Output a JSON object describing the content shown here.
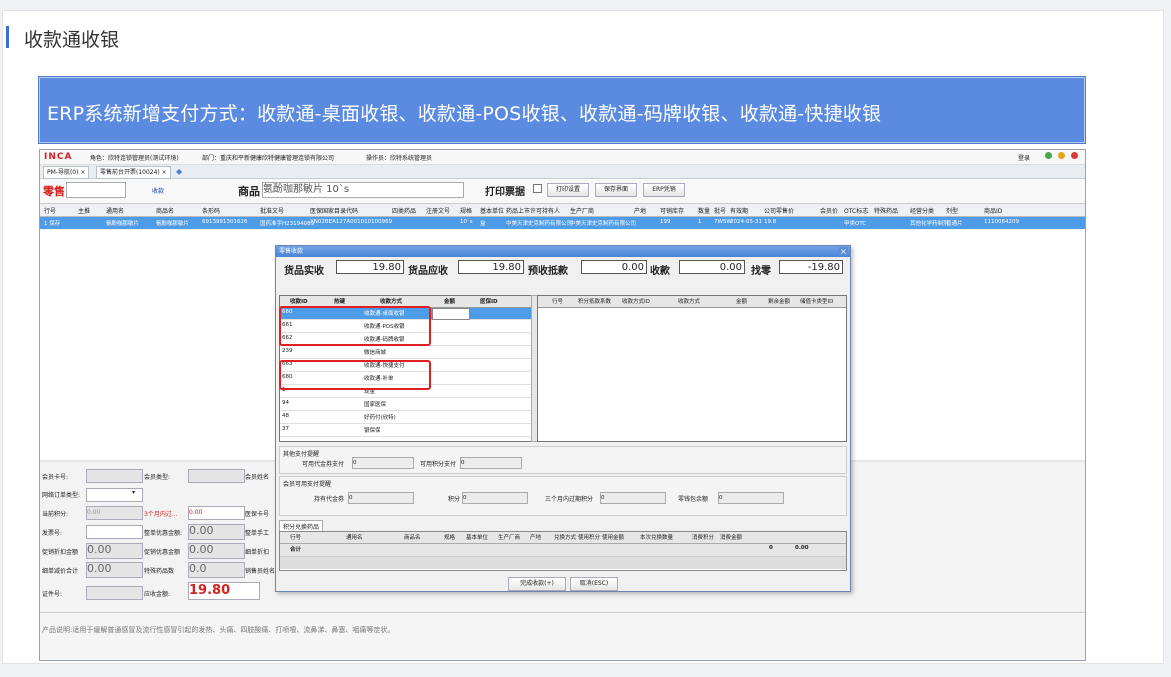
{
  "page": {
    "title": "收款通收银"
  },
  "banner": {
    "text": "ERP系统新增支付方式：收款通-桌面收银、收款通-POS收银、收款通-码牌收银、收款通-快捷收银"
  },
  "erp": {
    "logo": "INCA",
    "role": "角色：欣特连锁管理员(测试环境)",
    "dept": "部门：重庆和平新健康欣特健康管理连锁有限公司",
    "operator": "操作员：欣特系统管理员",
    "login": "登录",
    "tabs": [
      "PM-导航(0) ×",
      "零售前台开票(10024) ×"
    ],
    "toolbar": {
      "mode": "零售",
      "mode_sub": "收款",
      "product_label": "商品",
      "product_value": "氨酚咖那敏片 10`s",
      "print_label": "打印票据",
      "buttons": [
        "打印设置",
        "保存界面",
        "ERP凭销"
      ]
    },
    "grid_headers": [
      "行号",
      "主推",
      "通用名",
      "商品名",
      "条形码",
      "批准文号",
      "医保国家目录代码",
      "四类药品",
      "注册文号",
      "规格",
      "基本单位",
      "药品上市许可持有人",
      "生产厂商",
      "产地",
      "可销库存",
      "数量",
      "批号",
      "有效期",
      "公司零售价",
      "会员价",
      "OTC标志",
      "特殊药品",
      "经营分类",
      "剂型",
      "商品ID"
    ],
    "grid_row": [
      "1 保存",
      "",
      "氨酚咖那敏片",
      "氨酚咖那敏片",
      "6913991301626",
      "国药准字H23194089",
      "XN02BEA127A001010100969",
      "",
      "",
      "10`s",
      "盒",
      "中美天津史克制药有限公司",
      "中美天津史克制药有限公司",
      "",
      "199",
      "1",
      "7WSW",
      "2024-05-31",
      "19.8",
      "",
      "甲类OTC",
      "",
      "其他化学药制剂",
      "普通片",
      "1110064209"
    ],
    "lower": {
      "member_card": "会员卡号:",
      "member_type": "会员类型:",
      "member_name": "会员姓名",
      "order_type": "网络订单类型:",
      "points": "当前积分:",
      "points_val": "0.00",
      "points_expire": "3个月内过...",
      "points_expire_val": "0.00",
      "medical_card": "医保卡号",
      "invoice": "发票号:",
      "discount_total": "整单优惠金额:",
      "discount_total_val": "0.00",
      "manual": "整单手工",
      "promo_discount": "促销折扣金额",
      "promo_discount_val": "0.00",
      "promo_price": "促销优惠金额",
      "promo_price_val": "0.00",
      "detail_discount": "细单折扣",
      "detail_sum": "细单减价合计",
      "detail_sum_val": "0.00",
      "special_drug": "特殊药品数",
      "special_drug_val": "0.0",
      "sales_name": "销售员姓名",
      "id_no": "证件号:",
      "receivable": "应收金额:",
      "receivable_val": "19.80"
    },
    "description": "产品说明:适用于缓解普通感冒及流行性感冒引起的发热、头痛、四肢酸痛、打喷嚏、流鼻涕、鼻塞、咽痛等症状。"
  },
  "dialog": {
    "title": "零售收款",
    "close": "×",
    "amounts": [
      {
        "label": "货品实收",
        "value": "19.80"
      },
      {
        "label": "货品应收",
        "value": "19.80"
      },
      {
        "label": "预收抵款",
        "value": "0.00"
      },
      {
        "label": "收款",
        "value": "0.00"
      },
      {
        "label": "找零",
        "value": "-19.80"
      }
    ],
    "pay_headers": [
      "收款ID",
      "热键",
      "收款方式",
      "金额",
      "医保ID"
    ],
    "pay_rows": [
      {
        "id": "660",
        "name": "收款通-桌面收银"
      },
      {
        "id": "661",
        "name": "收款通-POS收银"
      },
      {
        "id": "662",
        "name": "收款通-码牌收银"
      },
      {
        "id": "239",
        "name": "微信商城"
      },
      {
        "id": "663",
        "name": "收款通-快捷支付"
      },
      {
        "id": "680",
        "name": "收款通-补单"
      },
      {
        "id": "1",
        "name": "现金"
      },
      {
        "id": "94",
        "name": "国家医保"
      },
      {
        "id": "48",
        "name": "好药付(欣特)"
      },
      {
        "id": "37",
        "name": "银保保"
      }
    ],
    "right_headers": [
      "行号",
      "积分抵款系数",
      "收款方式ID",
      "收款方式",
      "金额",
      "剩余金额",
      "储值卡类型ID"
    ],
    "other_pay": {
      "title": "其他支付提醒",
      "coupon_label": "可用代金券支付",
      "coupon_val": "0",
      "points_label": "可用积分支付",
      "points_val": "0"
    },
    "member_pay": {
      "title": "会员可用支付提醒",
      "coupon_label": "持有代金券",
      "coupon_val": "0",
      "points_label": "积分",
      "points_val": "0",
      "expire_label": "三个月内过期积分",
      "expire_val": "0",
      "change_label": "零钱包余额",
      "change_val": "0"
    },
    "exchange": {
      "tab": "积分兑换药品",
      "headers": [
        "行号",
        "通用名",
        "商品名",
        "规格",
        "基本单位",
        "生产厂商",
        "产地",
        "兑换方式",
        "使用积分",
        "使用金额",
        "本次兑换数量",
        "消费积分",
        "消费金额"
      ],
      "total_label": "合计",
      "total_points": "0",
      "total_amount": "0.00"
    },
    "buttons": [
      "完成收款(+)",
      "取消(ESC)"
    ]
  }
}
